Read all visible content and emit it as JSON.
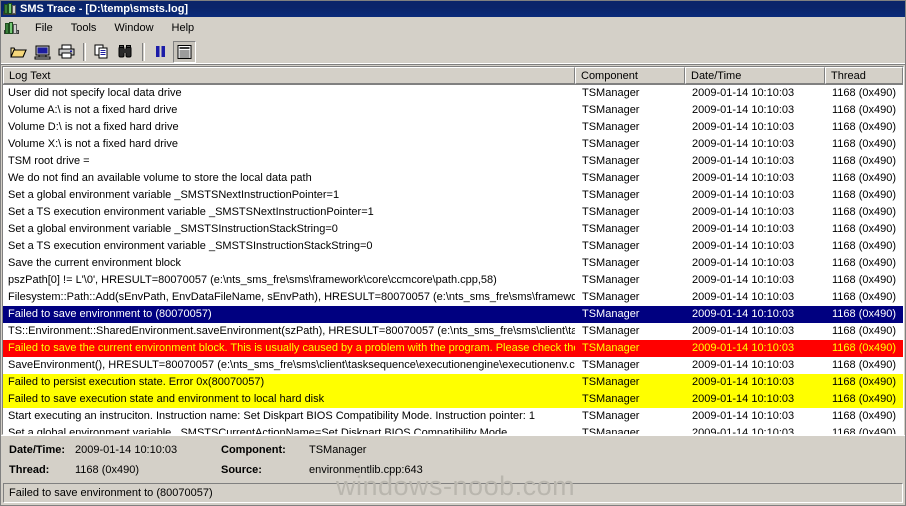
{
  "window": {
    "title": "SMS Trace - [D:\\temp\\smsts.log]",
    "icon": "sms-trace-icon"
  },
  "menu": {
    "icon": "sms-trace-icon",
    "items": [
      {
        "label": "File"
      },
      {
        "label": "Tools"
      },
      {
        "label": "Window"
      },
      {
        "label": "Help"
      }
    ]
  },
  "toolbar": {
    "buttons": [
      {
        "name": "open-file-button",
        "icon": "open-folder-icon",
        "pressed": false
      },
      {
        "name": "open-computer-log-button",
        "icon": "computer-icon",
        "pressed": false
      },
      {
        "name": "print-button",
        "icon": "printer-icon",
        "pressed": false
      },
      {
        "name": "copy-button",
        "icon": "copy-icon",
        "pressed": false
      },
      {
        "name": "find-button",
        "icon": "binoculars-icon",
        "pressed": false
      },
      {
        "name": "pause-button",
        "icon": "pause-icon",
        "pressed": false
      },
      {
        "name": "toggle-detail-pane-button",
        "icon": "list-view-icon",
        "pressed": true
      }
    ]
  },
  "log_table": {
    "columns": [
      {
        "key": "log",
        "label": "Log Text"
      },
      {
        "key": "component",
        "label": "Component"
      },
      {
        "key": "datetime",
        "label": "Date/Time"
      },
      {
        "key": "thread",
        "label": "Thread"
      }
    ],
    "rows": [
      {
        "log": "User did not specify local data drive",
        "component": "TSManager",
        "datetime": "2009-01-14 10:10:03",
        "thread": "1168 (0x490)",
        "style": "normal"
      },
      {
        "log": "Volume A:\\ is not a fixed hard drive",
        "component": "TSManager",
        "datetime": "2009-01-14 10:10:03",
        "thread": "1168 (0x490)",
        "style": "normal"
      },
      {
        "log": "Volume D:\\ is not a fixed hard drive",
        "component": "TSManager",
        "datetime": "2009-01-14 10:10:03",
        "thread": "1168 (0x490)",
        "style": "normal"
      },
      {
        "log": "Volume X:\\ is not a fixed hard drive",
        "component": "TSManager",
        "datetime": "2009-01-14 10:10:03",
        "thread": "1168 (0x490)",
        "style": "normal"
      },
      {
        "log": "TSM root drive =",
        "component": "TSManager",
        "datetime": "2009-01-14 10:10:03",
        "thread": "1168 (0x490)",
        "style": "normal"
      },
      {
        "log": "We do not find an available volume to store the local data path",
        "component": "TSManager",
        "datetime": "2009-01-14 10:10:03",
        "thread": "1168 (0x490)",
        "style": "normal"
      },
      {
        "log": "Set a global environment variable _SMSTSNextInstructionPointer=1",
        "component": "TSManager",
        "datetime": "2009-01-14 10:10:03",
        "thread": "1168 (0x490)",
        "style": "normal"
      },
      {
        "log": "Set a TS execution environment variable _SMSTSNextInstructionPointer=1",
        "component": "TSManager",
        "datetime": "2009-01-14 10:10:03",
        "thread": "1168 (0x490)",
        "style": "normal"
      },
      {
        "log": "Set a global environment variable _SMSTSInstructionStackString=0",
        "component": "TSManager",
        "datetime": "2009-01-14 10:10:03",
        "thread": "1168 (0x490)",
        "style": "normal"
      },
      {
        "log": "Set a TS execution environment variable _SMSTSInstructionStackString=0",
        "component": "TSManager",
        "datetime": "2009-01-14 10:10:03",
        "thread": "1168 (0x490)",
        "style": "normal"
      },
      {
        "log": "Save the current environment block",
        "component": "TSManager",
        "datetime": "2009-01-14 10:10:03",
        "thread": "1168 (0x490)",
        "style": "normal"
      },
      {
        "log": "pszPath[0] != L'\\0', HRESULT=80070057 (e:\\nts_sms_fre\\sms\\framework\\core\\ccmcore\\path.cpp,58)",
        "component": "TSManager",
        "datetime": "2009-01-14 10:10:03",
        "thread": "1168 (0x490)",
        "style": "normal"
      },
      {
        "log": "Filesystem::Path::Add(sEnvPath, EnvDataFileName, sEnvPath), HRESULT=80070057 (e:\\nts_sms_fre\\sms\\framework\\",
        "component": "TSManager",
        "datetime": "2009-01-14 10:10:03",
        "thread": "1168 (0x490)",
        "style": "normal"
      },
      {
        "log": "Failed to save environment to  (80070057)",
        "component": "TSManager",
        "datetime": "2009-01-14 10:10:03",
        "thread": "1168 (0x490)",
        "style": "selected"
      },
      {
        "log": "TS::Environment::SharedEnvironment.saveEnvironment(szPath), HRESULT=80070057 (e:\\nts_sms_fre\\sms\\client\\task",
        "component": "TSManager",
        "datetime": "2009-01-14 10:10:03",
        "thread": "1168 (0x490)",
        "style": "normal"
      },
      {
        "log": "Failed to save the current environment block. This is usually caused by a problem with the program. Please check the M",
        "component": "TSManager",
        "datetime": "2009-01-14 10:10:03",
        "thread": "1168 (0x490)",
        "style": "error"
      },
      {
        "log": "SaveEnvironment(), HRESULT=80070057 (e:\\nts_sms_fre\\sms\\client\\tasksequence\\executionengine\\executionenv.c:",
        "component": "TSManager",
        "datetime": "2009-01-14 10:10:03",
        "thread": "1168 (0x490)",
        "style": "normal"
      },
      {
        "log": "Failed to persist execution state. Error 0x(80070057)",
        "component": "TSManager",
        "datetime": "2009-01-14 10:10:03",
        "thread": "1168 (0x490)",
        "style": "warning"
      },
      {
        "log": "Failed to save execution state and environment to local hard disk",
        "component": "TSManager",
        "datetime": "2009-01-14 10:10:03",
        "thread": "1168 (0x490)",
        "style": "warning"
      },
      {
        "log": "Start executing an instruciton. Instruction name: Set Diskpart BIOS Compatibility Mode. Instruction pointer: 1",
        "component": "TSManager",
        "datetime": "2009-01-14 10:10:03",
        "thread": "1168 (0x490)",
        "style": "normal"
      },
      {
        "log": "Set a global environment variable _SMSTSCurrentActionName=Set Diskpart BIOS Compatibility Mode",
        "component": "TSManager",
        "datetime": "2009-01-14 10:10:03",
        "thread": "1168 (0x490)",
        "style": "normal"
      }
    ]
  },
  "detail": {
    "datetime_label": "Date/Time:",
    "datetime_value": "2009-01-14 10:10:03",
    "component_label": "Component:",
    "component_value": "TSManager",
    "thread_label": "Thread:",
    "thread_value": "1168 (0x490)",
    "source_label": "Source:",
    "source_value": "environmentlib.cpp:643"
  },
  "status_bar": {
    "text": "Failed to save environment to  (80070057)"
  },
  "watermark": {
    "text": "windows-noob.com"
  },
  "colors": {
    "title_bar": "#0a246a",
    "window_face": "#d4d0c8",
    "selected_row_bg": "#000080",
    "selected_row_fg": "#ffffff",
    "error_row_bg": "#ff0000",
    "error_row_fg": "#ffff00",
    "warning_row_bg": "#ffff00",
    "warning_row_fg": "#000000"
  }
}
